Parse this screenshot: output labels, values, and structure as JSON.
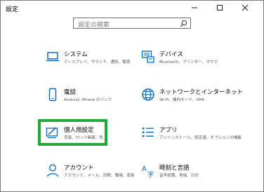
{
  "window": {
    "title": "設定"
  },
  "search": {
    "placeholder": "設定の検索"
  },
  "tiles": [
    {
      "id": "system",
      "name": "システム",
      "desc": "ディスプレイ、サウンド、通知、電源",
      "icon": "laptop-icon"
    },
    {
      "id": "devices",
      "name": "デバイス",
      "desc": "Bluetooth、プリンター、マウス",
      "icon": "keyboard-printer-icon"
    },
    {
      "id": "phone",
      "name": "電話",
      "desc": "Android, iPhone のリンク",
      "icon": "phone-icon"
    },
    {
      "id": "network",
      "name": "ネットワークとインターネット",
      "desc": "Wi-Fi、機内モード、VPN",
      "icon": "globe-icon"
    },
    {
      "id": "personalization",
      "name": "個人用設定",
      "desc": "背景、ロック画面、色",
      "icon": "paint-icon"
    },
    {
      "id": "apps",
      "name": "アプリ",
      "desc": "アンインストール、既定値、オプションの機能",
      "icon": "apps-list-icon"
    },
    {
      "id": "accounts",
      "name": "アカウント",
      "desc": "アカウント、メール、同期、職場、家族",
      "icon": "person-icon"
    },
    {
      "id": "time",
      "name": "時刻と言語",
      "desc": "音声認識、地域、日付",
      "icon": "language-icon"
    }
  ],
  "colors": {
    "accent": "#0067c0",
    "highlight": "#1daa37"
  }
}
